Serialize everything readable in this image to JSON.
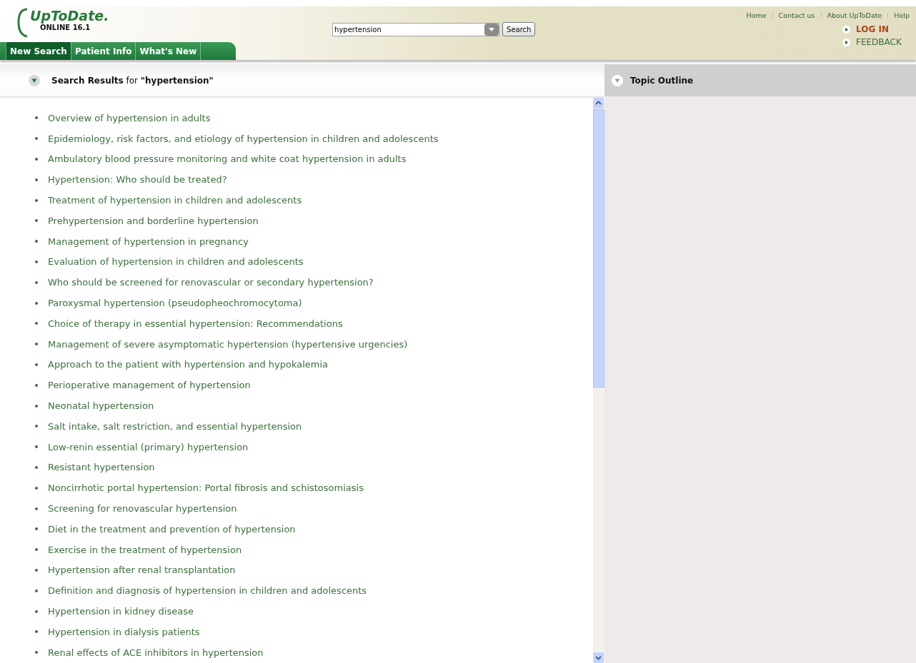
{
  "logo": {
    "name": "UpToDate.",
    "edition": "ONLINE 16.1"
  },
  "tabs": [
    {
      "label": "New Search",
      "selected": true
    },
    {
      "label": "Patient Info",
      "selected": false
    },
    {
      "label": "What's New",
      "selected": false
    }
  ],
  "search": {
    "value": "hypertension",
    "button": "Search"
  },
  "top_links": [
    "Home",
    "Contact us",
    "About UpToDate",
    "Help"
  ],
  "action_links": [
    {
      "label": "LOG IN",
      "kind": "login"
    },
    {
      "label": "FEEDBACK",
      "kind": "plain"
    }
  ],
  "results": {
    "heading": "**Search Results** for **\"hypertension\"**",
    "items": [
      "Overview of hypertension in adults",
      "Epidemiology, risk factors, and etiology of hypertension in children and adolescents",
      "Ambulatory blood pressure monitoring and white coat hypertension in adults",
      "Hypertension: Who should be treated?",
      "Treatment of hypertension in children and adolescents",
      "Prehypertension and borderline hypertension",
      "Management of hypertension in pregnancy",
      "Evaluation of hypertension in children and adolescents",
      "Who should be screened for renovascular or secondary hypertension?",
      "Paroxysmal hypertension (pseudopheochromocytoma)",
      "Choice of therapy in essential hypertension: Recommendations",
      "Management of severe asymptomatic hypertension (hypertensive urgencies)",
      "Approach to the patient with hypertension and hypokalemia",
      "Perioperative management of hypertension",
      "Neonatal hypertension",
      "Salt intake, salt restriction, and essential hypertension",
      "Low-renin essential (primary) hypertension",
      "Resistant hypertension",
      "Noncirrhotic portal hypertension: Portal fibrosis and schistosomiasis",
      "Screening for renovascular hypertension",
      "Diet in the treatment and prevention of hypertension",
      "Exercise in the treatment of hypertension",
      "Hypertension after renal transplantation",
      "Definition and diagnosis of hypertension in children and adolescents",
      "Hypertension in kidney disease",
      "Hypertension in dialysis patients",
      "Renal effects of ACE inhibitors in hypertension"
    ]
  },
  "outline": {
    "heading": "Topic Outline"
  }
}
